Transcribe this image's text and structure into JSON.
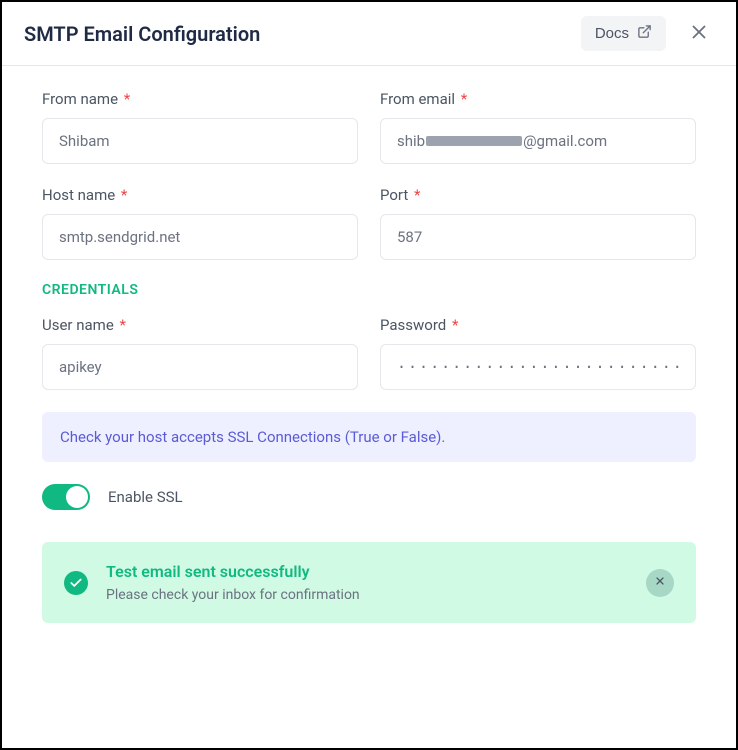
{
  "header": {
    "title": "SMTP Email Configuration",
    "docs_label": "Docs"
  },
  "fields": {
    "from_name": {
      "label": "From name",
      "value": "Shibam"
    },
    "from_email": {
      "label": "From email",
      "prefix": "shib",
      "suffix": "@gmail.com"
    },
    "host_name": {
      "label": "Host name",
      "value": "smtp.sendgrid.net"
    },
    "port": {
      "label": "Port",
      "value": "587"
    }
  },
  "credentials": {
    "section_title": "CREDENTIALS",
    "user_name": {
      "label": "User name",
      "value": "apikey"
    },
    "password": {
      "label": "Password",
      "value": "················································"
    }
  },
  "ssl": {
    "hint": "Check your host accepts SSL Connections (True or False).",
    "toggle_label": "Enable SSL",
    "enabled": true
  },
  "alert": {
    "title": "Test email sent successfully",
    "subtitle": "Please check your inbox for confirmation"
  },
  "colors": {
    "accent_green": "#10b981",
    "accent_purple": "#5b5bd6",
    "required_red": "#ef4444"
  }
}
